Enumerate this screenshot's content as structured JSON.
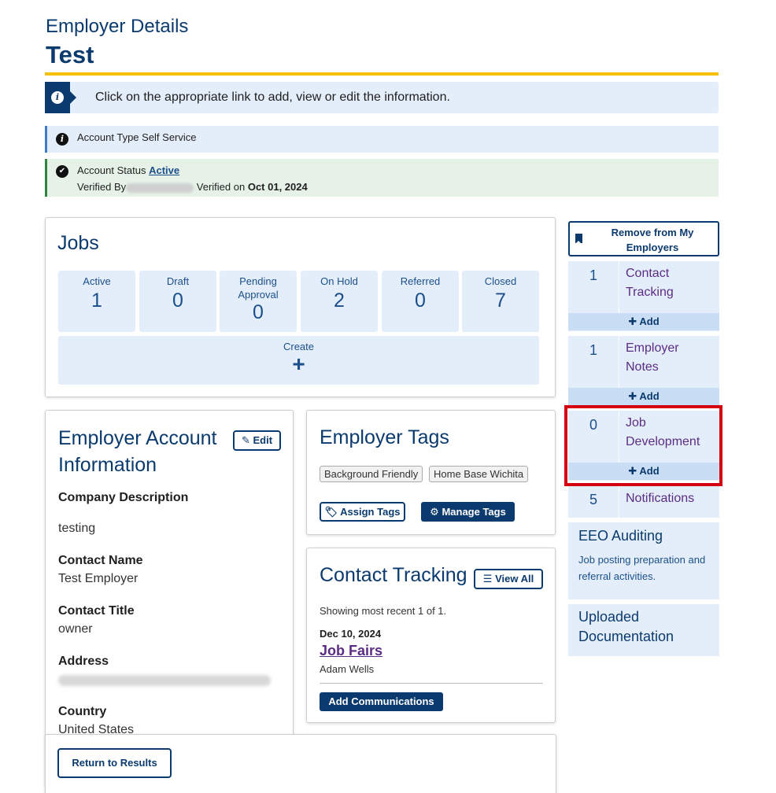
{
  "header": {
    "subtitle": "Employer Details",
    "title": "Test"
  },
  "banners": {
    "main": "Click on the appropriate link to add, view or edit the information.",
    "account_type": "Account Type Self Service",
    "status_label": "Account Status",
    "status_value": "Active",
    "verified_by_label": "Verified By",
    "verified_on_label": "Verified on",
    "verified_date": "Oct 01, 2024"
  },
  "jobs": {
    "title": "Jobs",
    "stats": [
      {
        "label": "Active",
        "value": "1"
      },
      {
        "label": "Draft",
        "value": "0"
      },
      {
        "label": "Pending Approval",
        "value": "0"
      },
      {
        "label": "On Hold",
        "value": "2"
      },
      {
        "label": "Referred",
        "value": "0"
      },
      {
        "label": "Closed",
        "value": "7"
      }
    ],
    "create_label": "Create",
    "create_icon": "+"
  },
  "account_info": {
    "title": "Employer Account Information",
    "edit_label": "Edit",
    "company_description_label": "Company Description",
    "company_description": "testing",
    "contact_name_label": "Contact Name",
    "contact_name": "Test Employer",
    "contact_title_label": "Contact Title",
    "contact_title": "owner",
    "address_label": "Address",
    "country_label": "Country",
    "country": "United States"
  },
  "tags": {
    "title": "Employer Tags",
    "items": [
      "Background Friendly",
      "Home Base Wichita"
    ],
    "assign_label": "Assign Tags",
    "manage_label": "Manage Tags"
  },
  "contact_tracking": {
    "title": "Contact Tracking",
    "view_all_label": "View All",
    "showing": "Showing most recent 1 of 1.",
    "date": "Dec 10, 2024",
    "link": "Job Fairs",
    "person": "Adam Wells",
    "add_label": "Add Communications"
  },
  "footer": {
    "return_label": "Return to Results"
  },
  "sidebar": {
    "remove_label": "Remove from My Employers",
    "add_label": "Add",
    "items": [
      {
        "count": "1",
        "label": "Contact Tracking"
      },
      {
        "count": "1",
        "label": "Employer Notes"
      },
      {
        "count": "0",
        "label": "Job Development"
      },
      {
        "count": "5",
        "label": "Notifications"
      }
    ],
    "eeo_title": "EEO Auditing",
    "eeo_desc": "Job posting preparation and referral activities.",
    "docs_title": "Uploaded Documentation"
  },
  "colors": {
    "brand_navy": "#0b3b6e",
    "gold_rule": "#f5c000",
    "light_blue": "#e4eefb",
    "link_purple": "#5b2c83",
    "highlight_red": "#d40012",
    "status_green": "#2e8540"
  }
}
